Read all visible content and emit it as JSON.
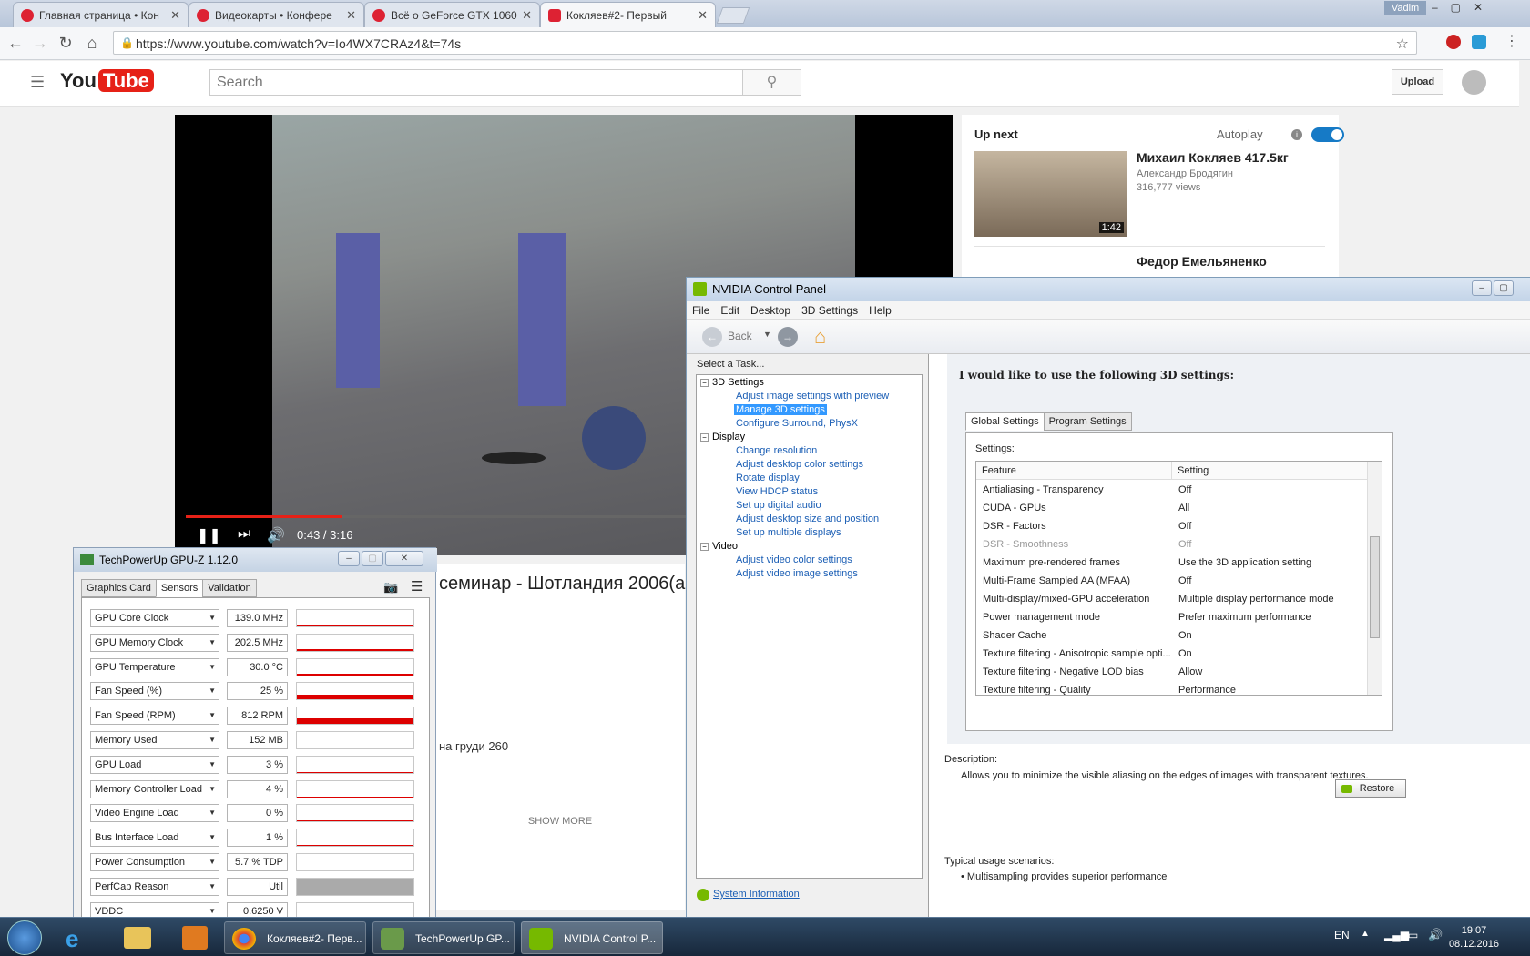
{
  "browser": {
    "tabs": [
      {
        "label": "Главная страница • Кон"
      },
      {
        "label": "Видеокарты • Конфере"
      },
      {
        "label": "Всё о GeForce GTX 1060"
      },
      {
        "label": "Кокляев#2- Первый"
      }
    ],
    "user": "Vadim",
    "url": "https://www.youtube.com/watch?v=Io4WX7CRAz4&t=74s"
  },
  "youtube": {
    "logo": "You",
    "logo_tube": "Tube",
    "search_placeholder": "Search",
    "upload": "Upload",
    "player": {
      "time": "0:43 / 3:16"
    },
    "video_title": "семинар - Шотландия 2006(а",
    "desc_snippet": "на груди 260",
    "show_more": "SHOW MORE",
    "up_next": {
      "heading": "Up next",
      "autoplay": "Autoplay",
      "item": {
        "title": "Михаил Кокляев 417.5кг",
        "channel": "Александр Бродягин",
        "views": "316,777 views",
        "duration": "1:42"
      },
      "item2": {
        "title": "Федор Емельяненко"
      }
    }
  },
  "nvidia": {
    "title": "NVIDIA Control Panel",
    "menu": [
      "File",
      "Edit",
      "Desktop",
      "3D Settings",
      "Help"
    ],
    "back": "Back",
    "select_task": "Select a Task...",
    "tree": [
      {
        "cat": "3D Settings",
        "items": [
          "Adjust image settings with preview",
          "Manage 3D settings",
          "Configure Surround, PhysX"
        ]
      },
      {
        "cat": "Display",
        "items": [
          "Change resolution",
          "Adjust desktop color settings",
          "Rotate display",
          "View HDCP status",
          "Set up digital audio",
          "Adjust desktop size and position",
          "Set up multiple displays"
        ]
      },
      {
        "cat": "Video",
        "items": [
          "Adjust video color settings",
          "Adjust video image settings"
        ]
      }
    ],
    "system_info": "System Information",
    "heading": "I would like to use the following 3D settings:",
    "tabs": [
      "Global Settings",
      "Program Settings"
    ],
    "settings_label": "Settings:",
    "col_feature": "Feature",
    "col_setting": "Setting",
    "rows": [
      {
        "f": "Antialiasing - Transparency",
        "s": "Off"
      },
      {
        "f": "CUDA - GPUs",
        "s": "All"
      },
      {
        "f": "DSR - Factors",
        "s": "Off"
      },
      {
        "f": "DSR - Smoothness",
        "s": "Off"
      },
      {
        "f": "Maximum pre-rendered frames",
        "s": "Use the 3D application setting"
      },
      {
        "f": "Multi-Frame Sampled AA (MFAA)",
        "s": "Off"
      },
      {
        "f": "Multi-display/mixed-GPU acceleration",
        "s": "Multiple display performance mode"
      },
      {
        "f": "Power management mode",
        "s": "Prefer maximum performance"
      },
      {
        "f": "Shader Cache",
        "s": "On"
      },
      {
        "f": "Texture filtering - Anisotropic sample opti...",
        "s": "On"
      },
      {
        "f": "Texture filtering - Negative LOD bias",
        "s": "Allow"
      },
      {
        "f": "Texture filtering - Quality",
        "s": "Performance"
      }
    ],
    "restore": "Restore",
    "description_label": "Description:",
    "description": "Allows you to minimize the visible aliasing on the edges of images with transparent textures.",
    "usage_label": "Typical usage scenarios:",
    "usage": "• Multisampling provides superior performance"
  },
  "gpuz": {
    "title": "TechPowerUp GPU-Z 1.12.0",
    "tabs": [
      "Graphics Card",
      "Sensors",
      "Validation"
    ],
    "sensors": [
      {
        "name": "GPU Core Clock",
        "value": "139.0 MHz",
        "level": 0.08
      },
      {
        "name": "GPU Memory Clock",
        "value": "202.5 MHz",
        "level": 0.08
      },
      {
        "name": "GPU Temperature",
        "value": "30.0 °C",
        "level": 0.12
      },
      {
        "name": "Fan Speed (%)",
        "value": "25 %",
        "level": 0.25
      },
      {
        "name": "Fan Speed (RPM)",
        "value": "812 RPM",
        "level": 0.3
      },
      {
        "name": "Memory Used",
        "value": "152 MB",
        "level": 0.0
      },
      {
        "name": "GPU Load",
        "value": "3 %",
        "level": 0.06
      },
      {
        "name": "Memory Controller Load",
        "value": "4 %",
        "level": 0.05
      },
      {
        "name": "Video Engine Load",
        "value": "0 %",
        "level": 0.0
      },
      {
        "name": "Bus Interface Load",
        "value": "1 %",
        "level": 0.02
      },
      {
        "name": "Power Consumption",
        "value": "5.7 % TDP",
        "level": 0.06
      },
      {
        "name": "PerfCap Reason",
        "value": "Util",
        "level": 1.0
      },
      {
        "name": "VDDC",
        "value": "0.6250 V",
        "level": 0.1
      }
    ]
  },
  "taskbar": {
    "buttons": [
      "Кокляев#2- Перв...",
      "TechPowerUp GP...",
      "NVIDIA Control P..."
    ],
    "lang": "EN",
    "time": "19:07",
    "date": "08.12.2016"
  }
}
